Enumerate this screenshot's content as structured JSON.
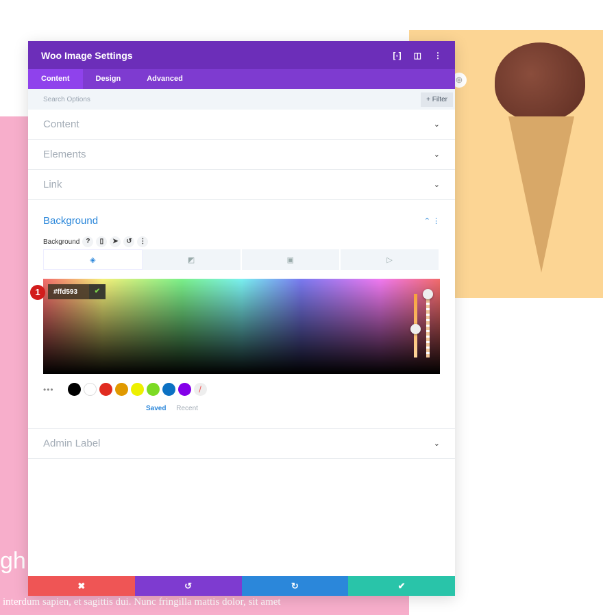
{
  "header": {
    "title": "Woo Image Settings"
  },
  "tabs": [
    {
      "label": "Content"
    },
    {
      "label": "Design"
    },
    {
      "label": "Advanced"
    }
  ],
  "search": {
    "placeholder": "Search Options",
    "filter_label": "+ Filter"
  },
  "sections": {
    "content": "Content",
    "elements": "Elements",
    "link": "Link",
    "admin_label": "Admin Label"
  },
  "background": {
    "title": "Background",
    "label": "Background",
    "help": "?",
    "hex_value": "#ffd593",
    "badge": "1",
    "saved": "Saved",
    "recent": "Recent",
    "swatches": [
      "#000000",
      "#ffffff",
      "#e02b20",
      "#e09900",
      "#edf000",
      "#7cda24",
      "#0c71c3",
      "#8300e9"
    ]
  },
  "page": {
    "heading_fragment": "gh",
    "body_text": "interdum sapien, et sagittis dui. Nunc fringilla mattis dolor, sit amet"
  },
  "footer": {
    "colors": {
      "cancel": "#ef5555",
      "undo": "#7e3bd0",
      "redo": "#2b87da",
      "save": "#29c4a9"
    }
  }
}
